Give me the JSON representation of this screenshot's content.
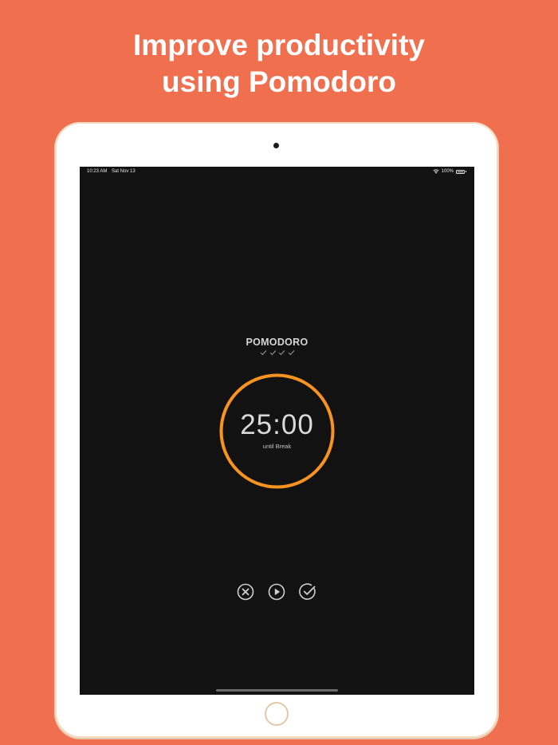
{
  "headline": {
    "line1": "Improve productivity",
    "line2": "using Pomodoro"
  },
  "status_bar": {
    "time": "10:23 AM",
    "date": "Sat Nov 13",
    "battery": "100%",
    "battery_level": 1.0
  },
  "app": {
    "title": "POMODORO",
    "completed_sessions": 4,
    "timer": "25:00",
    "timer_caption": "until Break",
    "ring_color": "#f7931e",
    "ring_progress": 1.0
  },
  "controls": {
    "stop_icon": "close-circle-icon",
    "play_icon": "play-circle-icon",
    "complete_icon": "check-circle-icon"
  },
  "colors": {
    "background": "#ef6f4f",
    "screen": "#121212",
    "accent": "#f7931e"
  }
}
